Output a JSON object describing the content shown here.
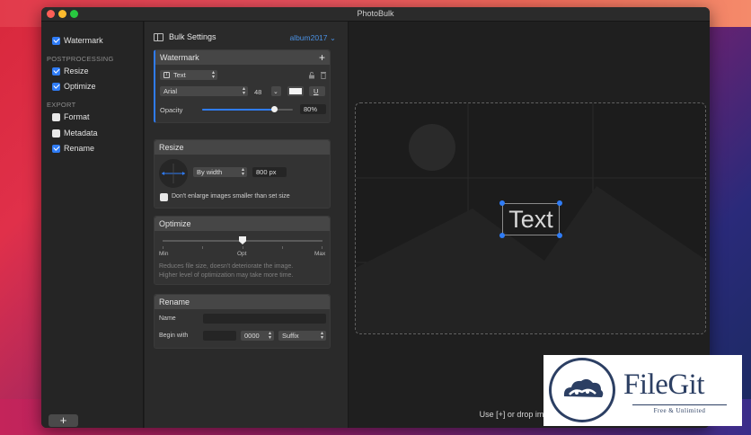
{
  "window": {
    "title": "PhotoBulk"
  },
  "sidebar": {
    "watermark": {
      "label": "Watermark",
      "checked": true
    },
    "postprocessing_header": "POSTPROCESSING",
    "resize": {
      "label": "Resize",
      "checked": true
    },
    "optimize": {
      "label": "Optimize",
      "checked": true
    },
    "export_header": "EXPORT",
    "format": {
      "label": "Format",
      "checked": false
    },
    "metadata": {
      "label": "Metadata",
      "checked": false
    },
    "rename": {
      "label": "Rename",
      "checked": true
    },
    "add_label": "+"
  },
  "settings": {
    "title": "Bulk Settings",
    "album": "album2017 ⌄",
    "watermark": {
      "title": "Watermark",
      "add_icon": "+",
      "type_select": "Text",
      "font": "Arial",
      "size": "48",
      "underline_label": "U",
      "opacity_label": "Opacity",
      "opacity_value": "80%",
      "opacity_fraction": 0.8
    },
    "resize": {
      "title": "Resize",
      "mode": "By width",
      "value": "800 px",
      "dont_enlarge": "Don't enlarge images smaller than set size",
      "dont_enlarge_checked": false
    },
    "optimize": {
      "title": "Optimize",
      "min_label": "Min",
      "opt_label": "Opt",
      "max_label": "Max",
      "level_fraction": 0.5,
      "help_line1": "Reduces file size, doesn't deteriorate the image.",
      "help_line2": "Higher level of optimization may take more time."
    },
    "rename": {
      "title": "Rename",
      "name_label": "Name",
      "name_value": "",
      "begin_label": "Begin with",
      "begin_value": "",
      "counter": "0000",
      "position": "Suffix"
    }
  },
  "canvas": {
    "watermark_text": "Text",
    "drop_hint": "Use [+] or drop images here"
  },
  "badge": {
    "brand": "FileGit",
    "tagline": "Free & Unlimited"
  },
  "colors": {
    "accent": "#2f7cf6",
    "album_link": "#4a90e2",
    "badge_navy": "#2c3f63"
  }
}
